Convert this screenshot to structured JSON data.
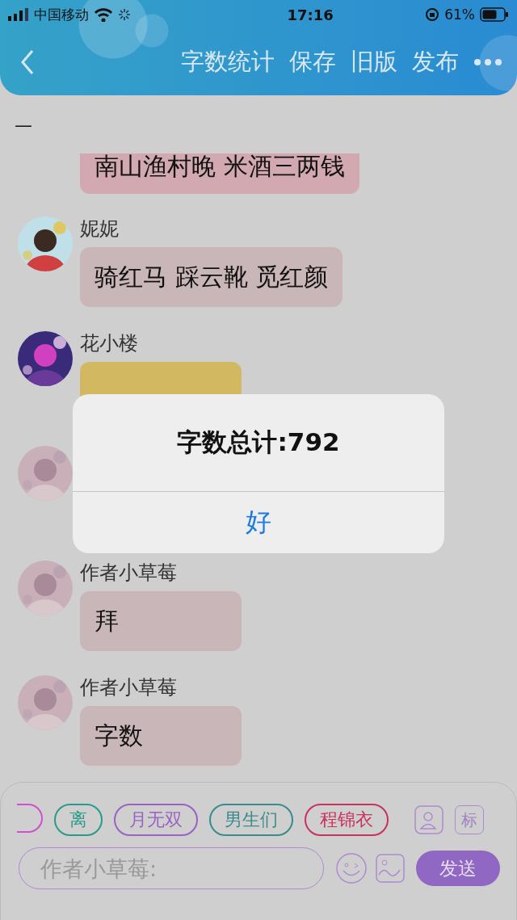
{
  "status_bar": {
    "carrier": "中国移动",
    "time": "17:16",
    "battery": "61%"
  },
  "nav": {
    "actions": [
      "字数统计",
      "保存",
      "旧版",
      "发布"
    ]
  },
  "dash": "—",
  "messages": [
    {
      "kind": "cut",
      "text": "南山渔村晚 米酒三两钱",
      "color": "#d3a9b1"
    },
    {
      "kind": "full",
      "name": "妮妮",
      "text": "骑红马 踩云靴 觅红颜",
      "color": "#c9b6b8"
    },
    {
      "kind": "full",
      "name": "花小楼",
      "color": "#d3b862"
    },
    {
      "kind": "hidden"
    },
    {
      "kind": "full",
      "name": "作者小草莓",
      "text": "拜",
      "color": "#c9b6b8"
    },
    {
      "kind": "full",
      "name": "作者小草莓",
      "text": "字数",
      "color": "#c9b6b8"
    }
  ],
  "dialog": {
    "message": "字数总计:792",
    "button": "好"
  },
  "composer": {
    "chips": [
      {
        "label": "离",
        "color": "#2a9a8a"
      },
      {
        "label": "月无双",
        "color": "#9a62c2"
      },
      {
        "label": "男生们",
        "color": "#3a8c8c"
      },
      {
        "label": "程锦衣",
        "color": "#c8325c"
      }
    ],
    "tag_button": "标",
    "placeholder": "作者小草莓:",
    "send": "发送"
  }
}
